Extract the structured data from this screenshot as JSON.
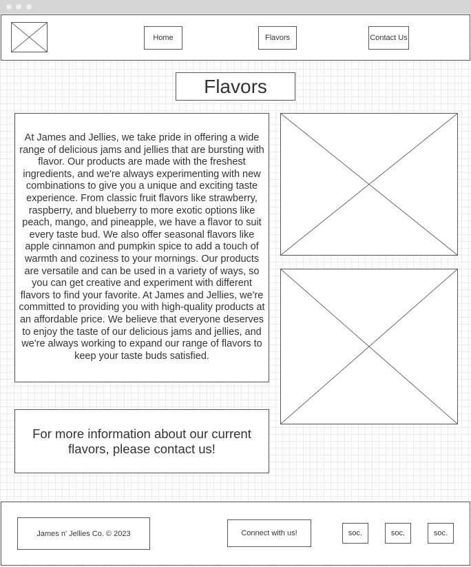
{
  "window": {
    "controls": [
      "close",
      "minimize",
      "maximize"
    ]
  },
  "header": {
    "logo_icon": "image-placeholder-icon",
    "nav": {
      "home": "Home",
      "flavors": "Flavors",
      "contact": "Contact Us"
    }
  },
  "main": {
    "title": "Flavors",
    "body_text": "At James and Jellies, we take pride in offering a wide range of delicious jams and jellies that are bursting with flavor. Our products are made with the freshest ingredients, and we're always experimenting with new combinations to give you a unique and exciting taste experience. From classic fruit flavors like strawberry, raspberry, and blueberry to more exotic options like peach, mango, and pineapple, we have a flavor to suit every taste bud. We also offer seasonal flavors like apple cinnamon and pumpkin spice to add a touch of warmth and coziness to your mornings. Our products are versatile and can be used in a variety of ways, so you can get creative and experiment with different flavors to find your favorite. At James and Jellies, we're committed to providing you with high-quality products at an affordable price. We believe that everyone deserves to enjoy the taste of our delicious jams and jellies, and we're always working to expand our range of flavors to keep your taste buds satisfied.",
    "contact_prompt": "For more information about our current flavors, please contact us!",
    "image_icons": [
      "image-placeholder-icon",
      "image-placeholder-icon"
    ]
  },
  "footer": {
    "copyright": "James n' Jellies Co. © 2023",
    "connect": "Connect with us!",
    "social": [
      "soc.",
      "soc.",
      "soc."
    ]
  }
}
